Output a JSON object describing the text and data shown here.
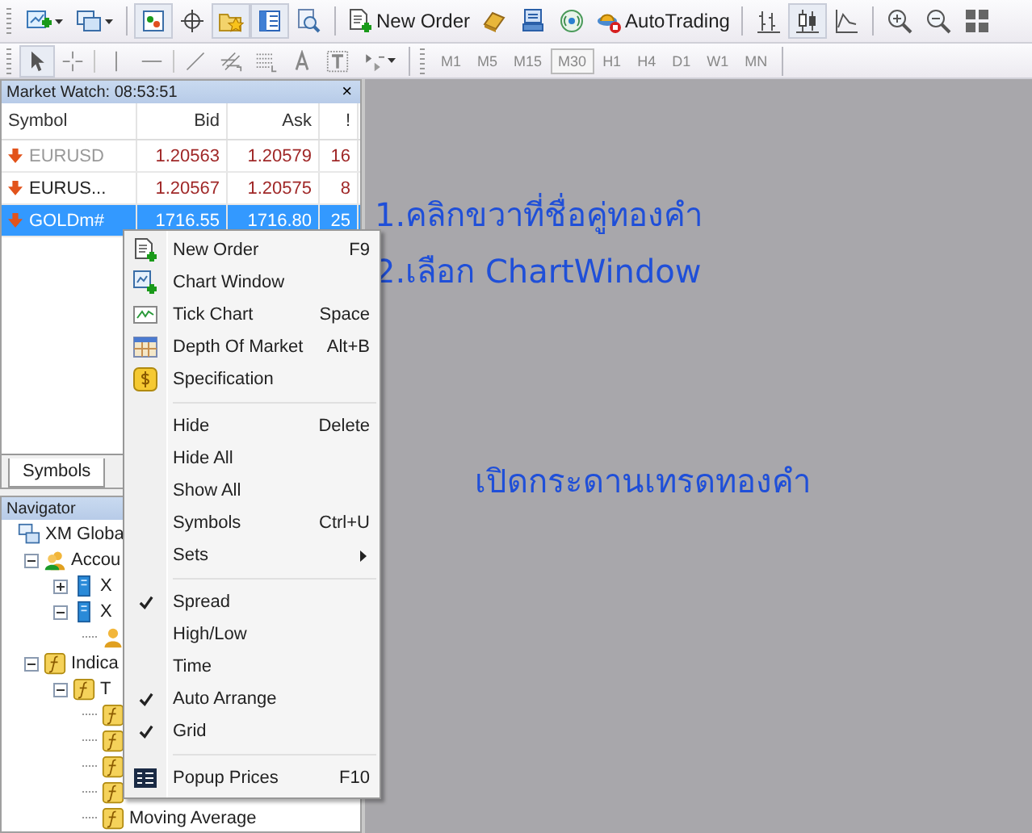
{
  "toolbar_1": [
    {
      "kind": "icon",
      "pressed": false,
      "dropdown": true
    },
    {
      "kind": "icon",
      "pressed": false,
      "dropdown": true
    },
    {
      "kind": "separator"
    },
    {
      "kind": "icon",
      "pressed": true
    },
    {
      "kind": "icon",
      "pressed": false
    },
    {
      "kind": "icon",
      "pressed": true
    },
    {
      "kind": "icon",
      "pressed": true
    },
    {
      "kind": "icon",
      "pressed": false
    },
    {
      "kind": "separator"
    },
    {
      "kind": "button",
      "label": "New Order"
    },
    {
      "kind": "icon",
      "pressed": false
    },
    {
      "kind": "icon",
      "pressed": false
    },
    {
      "kind": "icon",
      "pressed": false
    },
    {
      "kind": "button",
      "label": "AutoTrading"
    },
    {
      "kind": "separator"
    },
    {
      "kind": "icon",
      "pressed": false
    },
    {
      "kind": "icon",
      "pressed": true
    },
    {
      "kind": "icon",
      "pressed": false
    },
    {
      "kind": "separator"
    },
    {
      "kind": "icon",
      "pressed": false
    },
    {
      "kind": "icon",
      "pressed": false
    },
    {
      "kind": "icon",
      "pressed": false
    }
  ],
  "toolbar_2": {
    "tools": [
      {
        "pressed": true
      },
      {
        "pressed": false
      },
      {
        "pressed": false
      },
      {
        "pressed": false
      },
      {
        "pressed": false
      },
      {
        "pressed": false
      },
      {
        "pressed": false
      },
      {
        "pressed": false
      },
      {
        "pressed": false
      },
      {
        "pressed": false
      }
    ],
    "timeframes": [
      {
        "label": "M1",
        "selected": false
      },
      {
        "label": "M5",
        "selected": false
      },
      {
        "label": "M15",
        "selected": false
      },
      {
        "label": "M30",
        "selected": true
      },
      {
        "label": "H1",
        "selected": false
      },
      {
        "label": "H4",
        "selected": false
      },
      {
        "label": "D1",
        "selected": false
      },
      {
        "label": "W1",
        "selected": false
      },
      {
        "label": "MN",
        "selected": false
      }
    ]
  },
  "market_watch": {
    "title": "Market Watch: 08:53:51",
    "close": "×",
    "columns": [
      "Symbol",
      "Bid",
      "Ask",
      "!"
    ],
    "rows": [
      {
        "symbol": "EURUSD",
        "bid": "1.20563",
        "ask": "1.20579",
        "spread": "16",
        "selected": false,
        "dimmed": true
      },
      {
        "symbol": "EURUS...",
        "bid": "1.20567",
        "ask": "1.20575",
        "spread": "8",
        "selected": false,
        "dimmed": false
      },
      {
        "symbol": "GOLDm#",
        "bid": "1716.55",
        "ask": "1716.80",
        "spread": "25",
        "selected": true,
        "dimmed": false
      }
    ],
    "tabs": [
      {
        "label": "Symbols",
        "selected": true
      }
    ]
  },
  "navigator": {
    "title": "Navigator",
    "tree": [
      {
        "label": "XM Globa",
        "kind": "terminal",
        "children": [
          {
            "label": "Accou",
            "kind": "accounts",
            "expanded": true,
            "children": [
              {
                "label": "X",
                "kind": "server",
                "expanded": false
              },
              {
                "label": "X",
                "kind": "server",
                "expanded": true,
                "children": [
                  {
                    "kind": "account"
                  }
                ]
              }
            ]
          },
          {
            "label": "Indica",
            "kind": "indicators",
            "expanded": true,
            "children": [
              {
                "label": "T",
                "kind": "indicators",
                "expanded": true,
                "children": [
                  {
                    "kind": "indicator"
                  },
                  {
                    "kind": "indicator"
                  },
                  {
                    "kind": "indicator"
                  },
                  {
                    "kind": "indicator"
                  },
                  {
                    "label": "Moving Average",
                    "kind": "indicator"
                  }
                ]
              }
            ]
          }
        ]
      }
    ]
  },
  "annotations": [
    {
      "text": "1.คลิกขวาที่ชื่อคู่ทองคำ"
    },
    {
      "text": "2.เลือก ChartWindow"
    },
    {
      "text": "เปิดกระดานเทรดทองคำ"
    }
  ],
  "context_menu": {
    "items": [
      {
        "kind": "item",
        "label": "New Order",
        "shortcut": "F9",
        "checked": false
      },
      {
        "kind": "item",
        "label": "Chart Window",
        "checked": false
      },
      {
        "kind": "item",
        "label": "Tick Chart",
        "shortcut": "Space",
        "checked": false
      },
      {
        "kind": "item",
        "label": "Depth Of Market",
        "shortcut": "Alt+B",
        "checked": false
      },
      {
        "kind": "item",
        "label": "Specification",
        "checked": false
      },
      {
        "kind": "separator"
      },
      {
        "kind": "item",
        "label": "Hide",
        "shortcut": "Delete",
        "checked": false
      },
      {
        "kind": "item",
        "label": "Hide All",
        "checked": false
      },
      {
        "kind": "item",
        "label": "Show All",
        "checked": false
      },
      {
        "kind": "item",
        "label": "Symbols",
        "shortcut": "Ctrl+U",
        "checked": false
      },
      {
        "kind": "item",
        "label": "Sets",
        "submenu": true,
        "checked": false
      },
      {
        "kind": "separator"
      },
      {
        "kind": "item",
        "label": "Spread",
        "checked": true
      },
      {
        "kind": "item",
        "label": "High/Low",
        "checked": false
      },
      {
        "kind": "item",
        "label": "Time",
        "checked": false
      },
      {
        "kind": "item",
        "label": "Auto Arrange",
        "checked": true
      },
      {
        "kind": "item",
        "label": "Grid",
        "checked": true
      },
      {
        "kind": "separator"
      },
      {
        "kind": "item",
        "label": "Popup Prices",
        "shortcut": "F10",
        "checked": false
      }
    ]
  }
}
